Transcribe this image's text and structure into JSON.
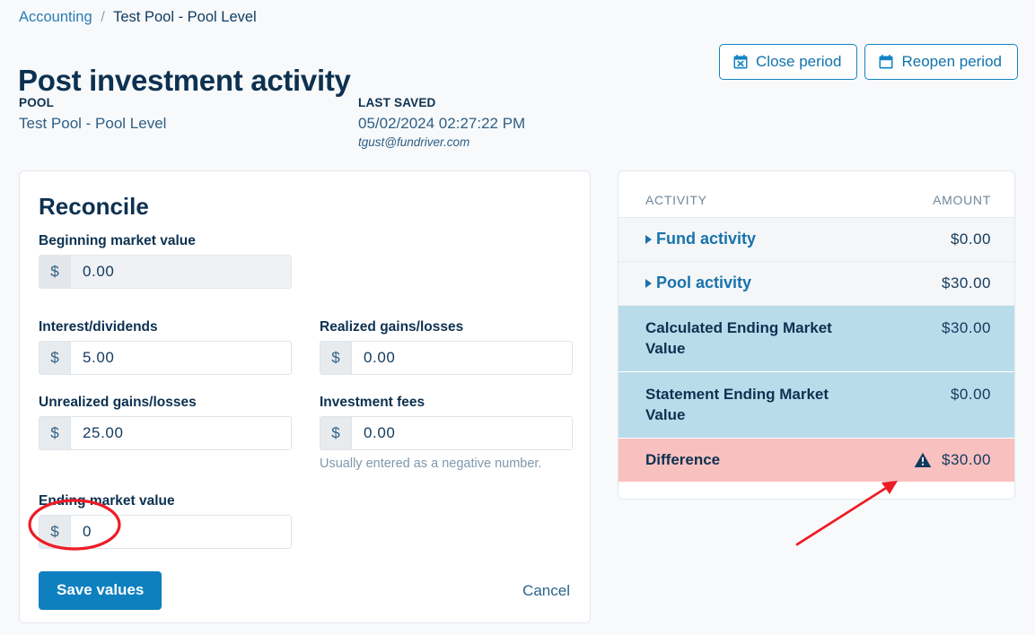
{
  "breadcrumb": {
    "root": "Accounting",
    "separator": "/",
    "current": "Test Pool - Pool Level"
  },
  "page_title": "Post investment activity",
  "header_actions": {
    "close_period": "Close period",
    "reopen_period": "Reopen period"
  },
  "meta": {
    "pool_label": "POOL",
    "pool_value": "Test Pool - Pool Level",
    "last_saved_label": "LAST SAVED",
    "last_saved_value": "05/02/2024  02:27:22  PM",
    "last_saved_user": "tgust@fundriver.com"
  },
  "reconcile": {
    "title": "Reconcile",
    "currency_symbol": "$",
    "fields": {
      "beginning_market_value": {
        "label": "Beginning market value",
        "value": "0.00",
        "disabled": true
      },
      "interest_dividends": {
        "label": "Interest/dividends",
        "value": "5.00",
        "disabled": false
      },
      "realized_gains_losses": {
        "label": "Realized gains/losses",
        "value": "0.00",
        "disabled": false
      },
      "unrealized_gains_losses": {
        "label": "Unrealized gains/losses",
        "value": "25.00",
        "disabled": false
      },
      "investment_fees": {
        "label": "Investment fees",
        "value": "0.00",
        "disabled": false,
        "help": "Usually entered as a negative number."
      },
      "ending_market_value": {
        "label": "Ending market value",
        "value": "0",
        "disabled": false
      }
    },
    "save_button": "Save values",
    "cancel_button": "Cancel"
  },
  "activity_panel": {
    "columns": {
      "activity": "ACTIVITY",
      "amount": "AMOUNT"
    },
    "rows": [
      {
        "label": "Fund activity",
        "amount": "$0.00",
        "type": "expandable"
      },
      {
        "label": "Pool activity",
        "amount": "$30.00",
        "type": "expandable"
      },
      {
        "label": "Calculated Ending Market Value",
        "amount": "$30.00",
        "type": "summary"
      },
      {
        "label": "Statement Ending Market Value",
        "amount": "$0.00",
        "type": "summary"
      },
      {
        "label": "Difference",
        "amount": "$30.00",
        "type": "difference",
        "warning": true
      }
    ]
  },
  "colors": {
    "page_background": "#f7f9fb",
    "navy_text": "#0d3150",
    "link_blue": "#1873ac",
    "primary_button": "#0e7fbf",
    "summary_row": "#b9dcea",
    "difference_row": "#f8c0bf",
    "annotation_red": "#ee1c25",
    "disabled_field": "#eff1f4"
  },
  "annotations": {
    "ellipse_target": "ending-market-value-input",
    "arrow_target": "difference-row"
  }
}
